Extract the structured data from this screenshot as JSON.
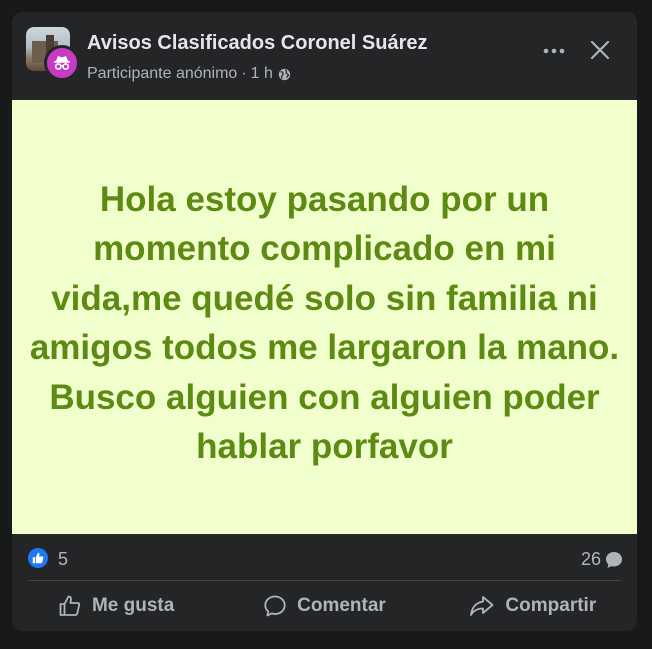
{
  "header": {
    "group_name": "Avisos Clasificados Coronel Suárez",
    "author": "Participante anónimo",
    "separator": "·",
    "time": "1 h",
    "privacy_icon": "globe-icon"
  },
  "post": {
    "text": "Hola estoy pasando por un momento complicado en mi vida,me quedé solo sin familia ni amigos todos me largaron la mano. Busco alguien con alguien poder hablar porfavor",
    "background_color": "#f1ffcc",
    "text_color": "#5c8a12"
  },
  "stats": {
    "reactions": "5",
    "comments": "26"
  },
  "actions": {
    "like": "Me gusta",
    "comment": "Comentar",
    "share": "Compartir"
  }
}
